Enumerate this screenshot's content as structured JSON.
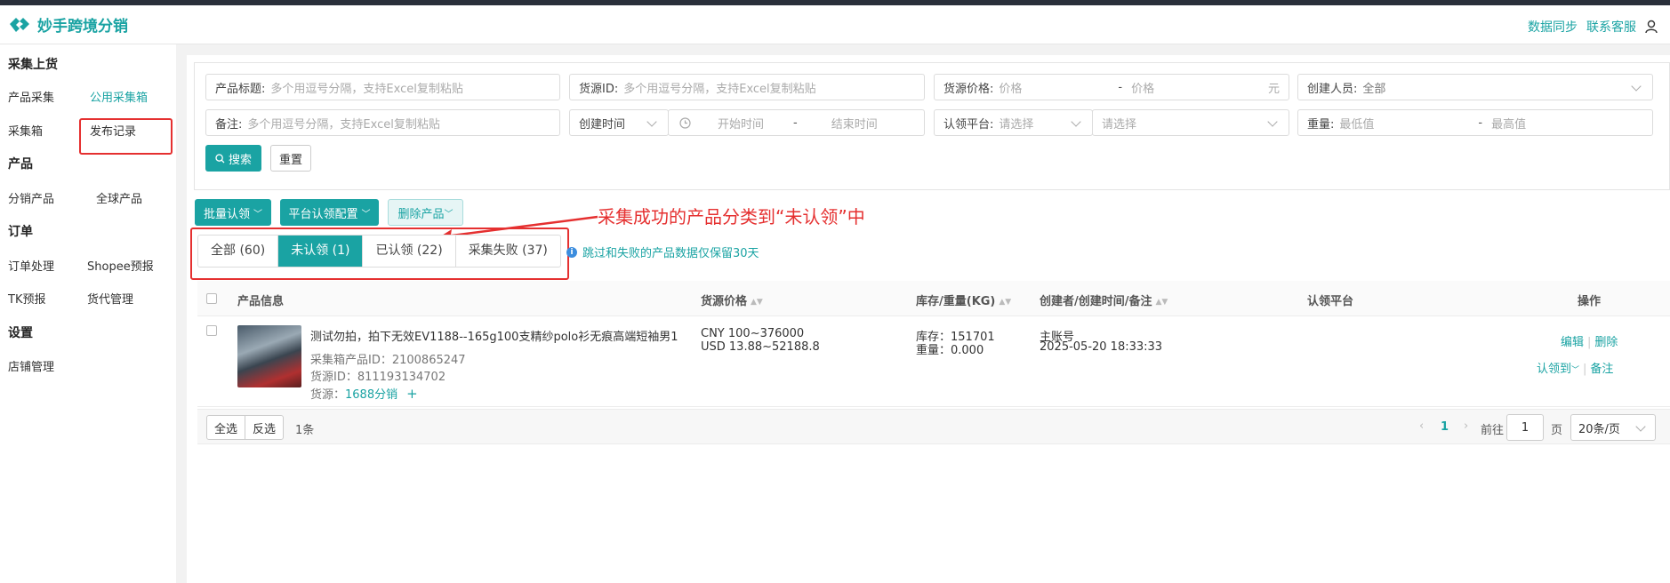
{
  "app": {
    "title": "妙手跨境分销"
  },
  "header": {
    "sync_label": "数据同步",
    "support_label": "联系客服"
  },
  "sidebar": {
    "groups": [
      {
        "title": "采集上货",
        "items": [
          "产品采集",
          "公用采集箱",
          "采集箱",
          "发布记录"
        ]
      },
      {
        "title": "产品",
        "items": [
          "分销产品",
          "全球产品"
        ]
      },
      {
        "title": "订单",
        "items": [
          "订单处理",
          "Shopee预报",
          "TK预报",
          "货代管理"
        ]
      },
      {
        "title": "设置",
        "items": [
          "店铺管理"
        ]
      }
    ],
    "active_item": "公用采集箱"
  },
  "filters": {
    "product_title": {
      "label": "产品标题:",
      "placeholder": "多个用逗号分隔，支持Excel复制粘贴"
    },
    "source_id": {
      "label": "货源ID:",
      "placeholder": "多个用逗号分隔，支持Excel复制粘贴"
    },
    "source_price": {
      "label": "货源价格:",
      "min_placeholder": "价格",
      "max_placeholder": "价格",
      "unit": "元",
      "sep": "-"
    },
    "creator": {
      "label": "创建人员:",
      "value": "全部"
    },
    "remark": {
      "label": "备注:",
      "placeholder": "多个用逗号分隔，支持Excel复制粘贴"
    },
    "time_type": {
      "value": "创建时间"
    },
    "time_range": {
      "start_placeholder": "开始时间",
      "end_placeholder": "结束时间",
      "sep": "-"
    },
    "claim_platform": {
      "label": "认领平台:",
      "placeholder": "请选择",
      "second_placeholder": "请选择"
    },
    "weight": {
      "label": "重量:",
      "min_placeholder": "最低值",
      "max_placeholder": "最高值",
      "sep": "-"
    },
    "search_label": "搜索",
    "reset_label": "重置"
  },
  "actions": {
    "batch_claim": "批量认领",
    "platform_config": "平台认领配置",
    "delete_products": "删除产品"
  },
  "annotation": "采集成功的产品分类到“未认领”中",
  "tabs": [
    {
      "label": "全部 (60)"
    },
    {
      "label": "未认领 (1)"
    },
    {
      "label": "已认领 (22)"
    },
    {
      "label": "采集失败 (37)"
    }
  ],
  "notice": "跳过和失败的产品数据仅保留30天",
  "table": {
    "headers": {
      "product": "产品信息",
      "price": "货源价格",
      "stock": "库存/重量(KG)",
      "creator": "创建者/创建时间/备注",
      "platform": "认领平台",
      "ops": "操作"
    },
    "rows": [
      {
        "title": "测试勿拍，拍下无效EV1188--165g100支精纱polo衫无痕高端短袖男1",
        "box_id": "采集箱产品ID：2100865247",
        "source_id": "货源ID：811193134702",
        "source_label": "货源：",
        "source_link": "1688分销",
        "price_cny": "CNY 100~376000",
        "price_usd": "USD 13.88~52188.8",
        "stock": "库存：151701",
        "weight": "重量：0.000",
        "creator": "主账号",
        "created_at": "2025-05-20 18:33:33",
        "ops": {
          "edit": "编辑",
          "delete": "删除",
          "claim_to": "认领到",
          "remark": "备注"
        }
      }
    ]
  },
  "footer": {
    "select_all": "全选",
    "invert": "反选",
    "count": "1条",
    "current_page": "1",
    "goto_label": "前往",
    "goto_value": "1",
    "page_unit": "页",
    "page_size": "20条/页"
  },
  "colors": {
    "accent": "#1aa3a3",
    "annotation": "#e53030"
  }
}
